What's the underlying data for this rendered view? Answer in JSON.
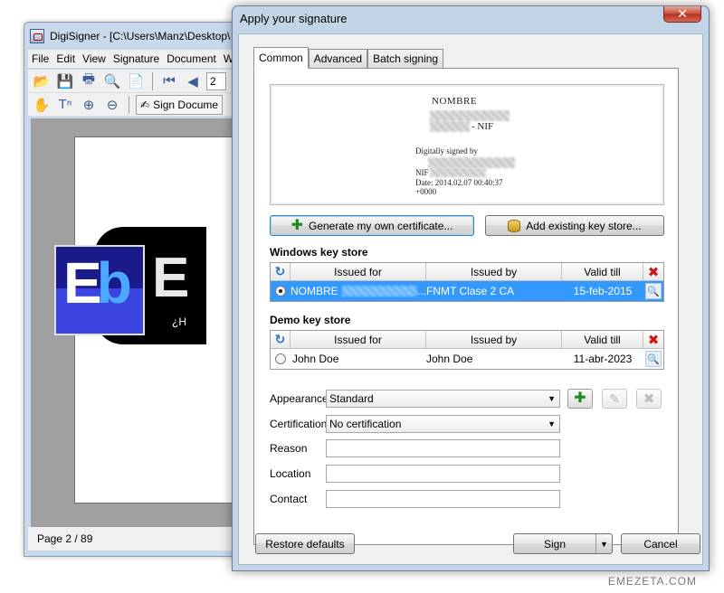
{
  "main_window": {
    "title": "DigiSigner - [C:\\Users\\Manz\\Desktop\\",
    "menu": [
      "File",
      "Edit",
      "View",
      "Signature",
      "Document",
      "W"
    ],
    "page_field": "2",
    "sign_document_label": "Sign Docume",
    "status": "Page 2 / 89",
    "doc_logo": {
      "e": "E",
      "b": "b",
      "partial_e": "E",
      "partial_q": "¿H"
    }
  },
  "dialog": {
    "title": "Apply your signature",
    "close_symbol": "✕",
    "tabs": [
      "Common",
      "Advanced",
      "Batch signing"
    ],
    "preview": {
      "name": "NOMBRE",
      "nif_suffix": "- NIF",
      "digitally_signed": "Digitally signed by",
      "nif_label": "NIF",
      "date_line1": "Date: 2014.02.07 00:40:37",
      "date_line2": "+0000"
    },
    "buttons": {
      "generate": "Generate my own certificate...",
      "add_store": "Add existing key store...",
      "restore": "Restore defaults",
      "sign": "Sign",
      "cancel": "Cancel"
    },
    "windows_store": {
      "title": "Windows key store",
      "columns": [
        "Issued for",
        "Issued by",
        "Valid till"
      ],
      "rows": [
        {
          "issued_for": "NOMBRE",
          "ellipsis": "...",
          "issued_by": "FNMT Clase 2 CA",
          "valid_till": "15-feb-2015"
        }
      ]
    },
    "demo_store": {
      "title": "Demo key store",
      "columns": [
        "Issued for",
        "Issued by",
        "Valid till"
      ],
      "rows": [
        {
          "issued_for": "John Doe",
          "issued_by": "John Doe",
          "valid_till": "11-abr-2023"
        }
      ]
    },
    "form": {
      "appearance_label": "Appearance",
      "appearance_value": "Standard",
      "certification_label": "Certification",
      "certification_value": "No certification",
      "reason_label": "Reason",
      "location_label": "Location",
      "contact_label": "Contact"
    }
  },
  "watermark": "EMEZETA.COM",
  "icons": {
    "refresh": "↻",
    "delete": "✖",
    "magnifier": "🔍",
    "plus": "✚",
    "pencil": "✎",
    "x_gray": "✖",
    "dropdown": "▼"
  }
}
